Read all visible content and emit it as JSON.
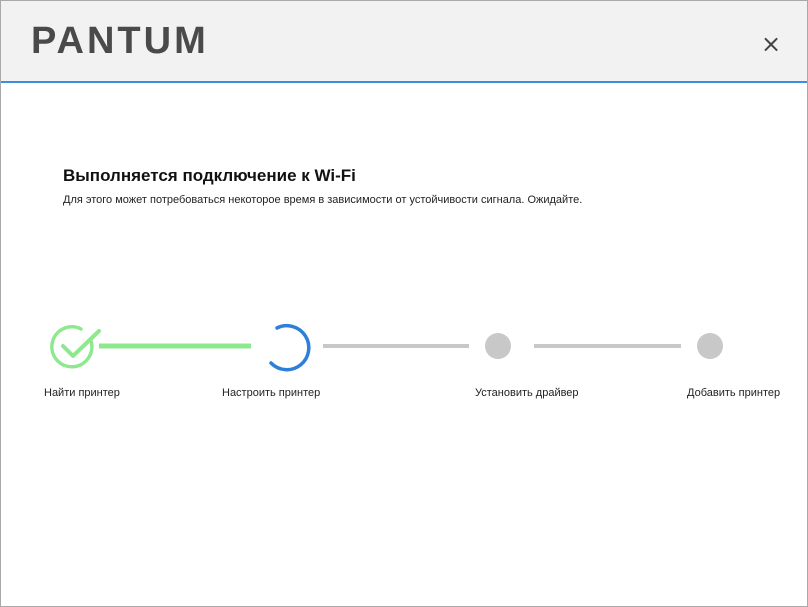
{
  "window": {
    "logo_text": "PANTUM",
    "close_glyph": "×"
  },
  "content": {
    "heading": "Выполняется подключение к Wi-Fi",
    "subtitle": "Для этого может потребоваться некоторое время в зависимости от устойчивости сигнала. Ожидайте."
  },
  "steps": [
    {
      "label": "Найти принтер",
      "status": "done",
      "icon": "checkmark-circle-icon"
    },
    {
      "label": "Настроить принтер",
      "status": "in-progress",
      "icon": "spinner-icon"
    },
    {
      "label": "Установить драйвер",
      "status": "pending",
      "icon": "pending-dot-icon"
    },
    {
      "label": "Добавить принтер",
      "status": "pending",
      "icon": "pending-dot-icon"
    }
  ],
  "colors": {
    "accent_blue": "#2e7fd8",
    "done_green": "#8ee98e",
    "pending_gray": "#c8c8c8",
    "titlebar_border": "#3d8ee3"
  }
}
